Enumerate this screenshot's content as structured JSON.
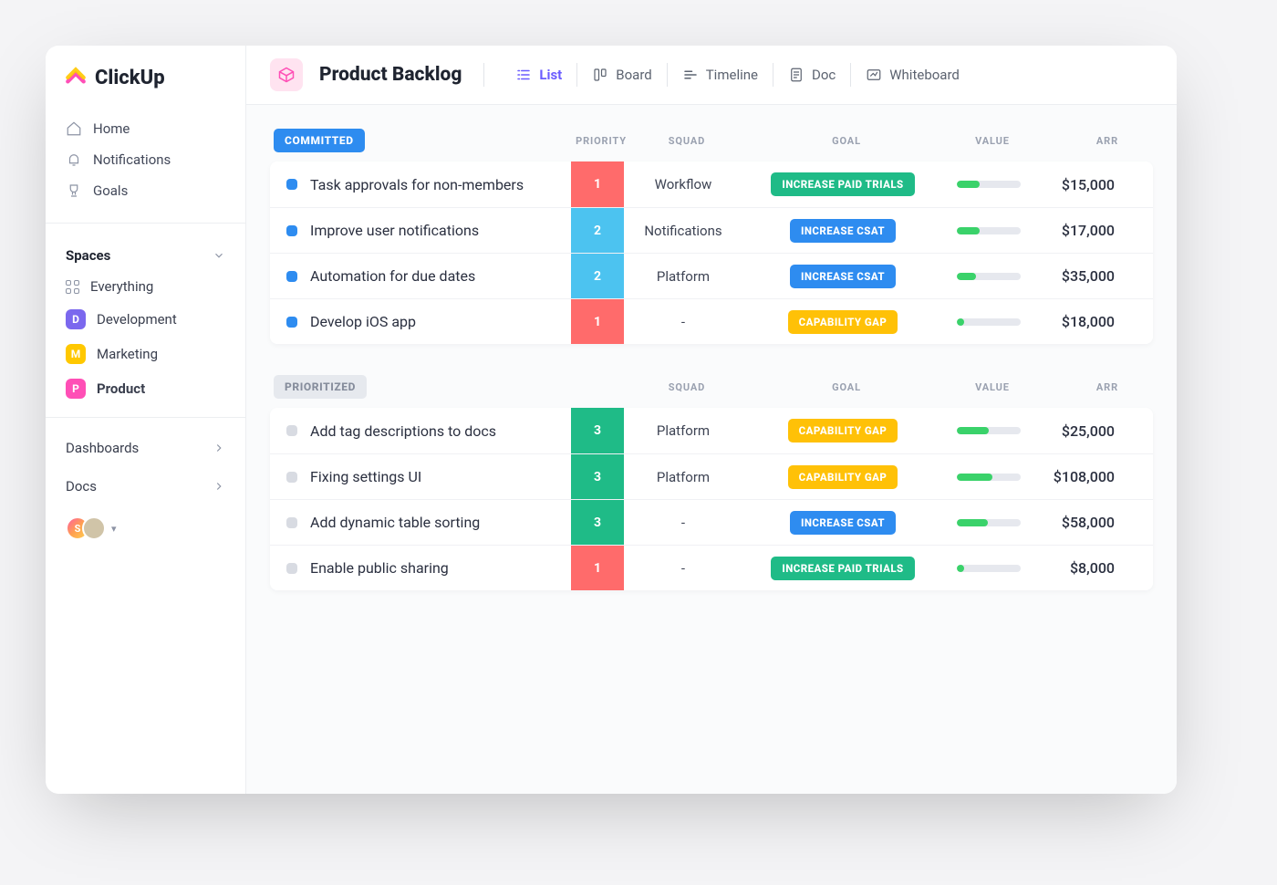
{
  "brand": "ClickUp",
  "sidebar": {
    "nav": [
      {
        "label": "Home"
      },
      {
        "label": "Notifications"
      },
      {
        "label": "Goals"
      }
    ],
    "spaces_title": "Spaces",
    "everything": "Everything",
    "spaces": [
      {
        "letter": "D",
        "label": "Development",
        "cls": "dev"
      },
      {
        "letter": "M",
        "label": "Marketing",
        "cls": "mkt"
      },
      {
        "letter": "P",
        "label": "Product",
        "cls": "prd",
        "active": true
      }
    ],
    "links": [
      {
        "label": "Dashboards"
      },
      {
        "label": "Docs"
      }
    ],
    "avatars": [
      {
        "letter": "S"
      },
      {
        "letter": ""
      }
    ]
  },
  "page": {
    "title": "Product Backlog",
    "views": [
      {
        "label": "List",
        "active": true
      },
      {
        "label": "Board"
      },
      {
        "label": "Timeline"
      },
      {
        "label": "Doc"
      },
      {
        "label": "Whiteboard"
      }
    ]
  },
  "columns": {
    "priority": "PRIORITY",
    "squad": "SQUAD",
    "goal": "GOAL",
    "value": "VALUE",
    "arr": "ARR"
  },
  "groups": [
    {
      "name": "COMMITTED",
      "pill_cls": "committed",
      "show_priority_header": true,
      "dot_cls": "dot-blue",
      "tasks": [
        {
          "title": "Task approvals for non-members",
          "priority": "1",
          "prio_cls": "p1",
          "squad": "Workflow",
          "goal": "INCREASE PAID TRIALS",
          "goal_cls": "g-green",
          "value_pct": 35,
          "arr": "$15,000"
        },
        {
          "title": "Improve  user notifications",
          "priority": "2",
          "prio_cls": "p2",
          "squad": "Notifications",
          "goal": "INCREASE CSAT",
          "goal_cls": "g-blue",
          "value_pct": 35,
          "arr": "$17,000"
        },
        {
          "title": "Automation for due dates",
          "priority": "2",
          "prio_cls": "p2",
          "squad": "Platform",
          "goal": "INCREASE CSAT",
          "goal_cls": "g-blue",
          "value_pct": 30,
          "arr": "$35,000"
        },
        {
          "title": "Develop iOS app",
          "priority": "1",
          "prio_cls": "p1",
          "squad": "-",
          "goal": "CAPABILITY GAP",
          "goal_cls": "g-yell",
          "value_pct": 12,
          "arr": "$18,000"
        }
      ]
    },
    {
      "name": "PRIORITIZED",
      "pill_cls": "prioritized",
      "show_priority_header": false,
      "dot_cls": "dot-grey",
      "tasks": [
        {
          "title": "Add tag descriptions to docs",
          "priority": "3",
          "prio_cls": "p3",
          "squad": "Platform",
          "goal": "CAPABILITY GAP",
          "goal_cls": "g-yell",
          "value_pct": 50,
          "arr": "$25,000"
        },
        {
          "title": "Fixing settings UI",
          "priority": "3",
          "prio_cls": "p3",
          "squad": "Platform",
          "goal": "CAPABILITY GAP",
          "goal_cls": "g-yell",
          "value_pct": 55,
          "arr": "$108,000"
        },
        {
          "title": "Add dynamic table sorting",
          "priority": "3",
          "prio_cls": "p3",
          "squad": "-",
          "goal": "INCREASE CSAT",
          "goal_cls": "g-blue",
          "value_pct": 48,
          "arr": "$58,000"
        },
        {
          "title": "Enable public sharing",
          "priority": "1",
          "prio_cls": "p1",
          "squad": "-",
          "goal": "INCREASE PAID TRIALS",
          "goal_cls": "g-green",
          "value_pct": 12,
          "arr": "$8,000"
        }
      ]
    }
  ]
}
